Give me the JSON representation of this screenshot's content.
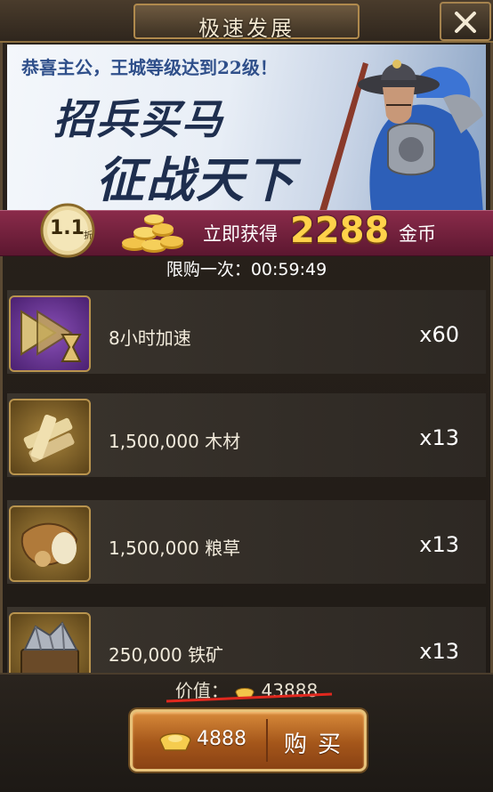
{
  "window": {
    "title": "极速发展"
  },
  "banner": {
    "headline": "恭喜主公，王城等级达到22级！",
    "slogan_line1": "招兵买马",
    "slogan_line2": "征战天下"
  },
  "offer": {
    "discount_value": "1.1",
    "discount_unit": "折",
    "prefix": "立即获得",
    "amount": "2288",
    "suffix": "金币"
  },
  "limit_text": "限购一次：00:59:49",
  "items": [
    {
      "name": "8小时加速",
      "qty": "x60",
      "icon": "speedup-hourglass-icon"
    },
    {
      "name": "1,500,000  木材",
      "qty": "x13",
      "icon": "wood-icon"
    },
    {
      "name": "1,500,000  粮草",
      "qty": "x13",
      "icon": "grain-sack-icon"
    },
    {
      "name": "250,000  铁矿",
      "qty": "x13",
      "icon": "iron-ore-icon"
    }
  ],
  "footer": {
    "value_label": "价值：",
    "original_price": "43888",
    "price": "4888",
    "buy_label": "购买"
  },
  "colors": {
    "offer_bar": "#8a2b4a",
    "gold_text": "#ffd24a",
    "button": "#b8641f"
  }
}
